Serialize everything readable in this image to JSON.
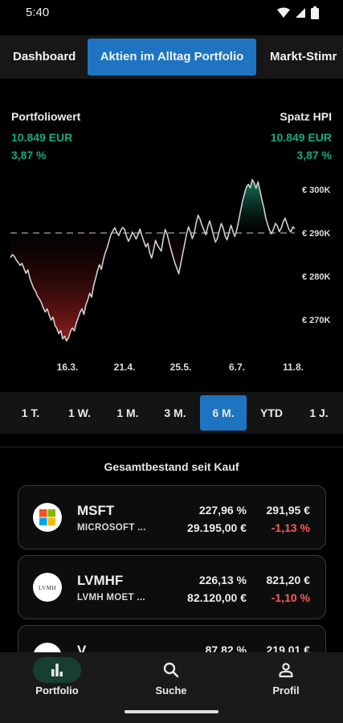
{
  "status_bar": {
    "time": "5:40"
  },
  "tabs": [
    {
      "label": "Dashboard",
      "active": false
    },
    {
      "label": "Aktien im Alltag Portfolio",
      "active": true
    },
    {
      "label": "Markt-Stimr",
      "active": false
    }
  ],
  "portfolio": {
    "left_title": "Portfoliowert",
    "left_value": "10.849 EUR",
    "left_pct": "3,87 %",
    "right_title": "Spatz HPI",
    "right_value": "10.849 EUR",
    "right_pct": "3,87 %"
  },
  "chart_data": {
    "type": "line",
    "y_tick_labels": [
      "€ 300K",
      "€ 290K",
      "€ 280K",
      "€ 270K"
    ],
    "y_ticks": [
      300,
      290,
      280,
      270
    ],
    "x_tick_labels": [
      "16.3.",
      "21.4.",
      "25.5.",
      "6.7.",
      "11.8."
    ],
    "baseline": 290,
    "ylim": [
      262,
      304
    ],
    "series": [
      {
        "values": [
          284.3,
          285,
          284.6,
          283.8,
          283.2,
          282.5,
          283,
          281.8,
          280.7,
          281.5,
          279.6,
          278.4,
          277.2,
          276.6,
          275.4,
          274.8,
          273.9,
          272.7,
          271.8,
          272.5,
          271.1,
          269.9,
          270.6,
          268.7,
          268,
          266.8,
          267.5,
          265.6,
          266.2,
          265.1,
          265.8,
          267.3,
          268.1,
          267.4,
          269.2,
          270.4,
          271.7,
          272.5,
          271.2,
          273.4,
          274.6,
          276.1,
          275.2,
          277.9,
          279.5,
          281.3,
          282.7,
          281.6,
          283.8,
          285.4,
          286.6,
          288.2,
          289.7,
          290.5,
          291.2,
          290.1,
          289.4,
          290.6,
          291.3,
          290.8,
          289.2,
          288.1,
          288.9,
          290.2,
          289.5,
          288.6,
          289.7,
          290.9,
          289.3,
          288,
          286.8,
          287.6,
          285.4,
          284.2,
          286.1,
          288.3,
          287.2,
          286.5,
          285.8,
          288.6,
          290.8,
          289.7,
          287.9,
          286.2,
          284.6,
          283.1,
          281.9,
          280.6,
          282.8,
          285.1,
          287.3,
          289.6,
          291.4,
          290.2,
          288.7,
          289.9,
          292.3,
          294.1,
          293.2,
          291.8,
          290.7,
          289.6,
          291.4,
          292.8,
          291.2,
          289.4,
          287.9,
          288.8,
          290.6,
          292.2,
          291.1,
          289.3,
          288.4,
          290.1,
          291.8,
          290.4,
          289.2,
          290.7,
          292.9,
          295.2,
          297.4,
          299.1,
          300.6,
          301.2,
          300.4,
          302.3,
          301.6,
          300.3,
          301.8,
          299.7,
          297.6,
          295.8,
          293.4,
          291.9,
          290.6,
          289.8,
          290.9,
          292.2,
          291.6,
          290.3,
          291.1,
          292.6,
          293.4,
          292.1,
          290.8,
          290.2,
          291.4,
          291
        ]
      }
    ]
  },
  "time_ranges": [
    {
      "label": "1 T.",
      "active": false
    },
    {
      "label": "1 W.",
      "active": false
    },
    {
      "label": "1 M.",
      "active": false
    },
    {
      "label": "3 M.",
      "active": false
    },
    {
      "label": "6 M.",
      "active": true
    },
    {
      "label": "YTD",
      "active": false
    },
    {
      "label": "1 J.",
      "active": false
    }
  ],
  "holdings_title": "Gesamtbestand seit Kauf",
  "holdings": [
    {
      "symbol": "MSFT",
      "name": "MICROSOFT ...",
      "pct_gain": "227,96 %",
      "price": "291,95 €",
      "value": "29.195,00 €",
      "day_change": "-1,13 %",
      "logo_icon": "microsoft-logo-icon",
      "logo_text": ""
    },
    {
      "symbol": "LVMHF",
      "name": "LVMH MOET ...",
      "pct_gain": "226,13 %",
      "price": "821,20 €",
      "value": "82.120,00 €",
      "day_change": "-1,10 %",
      "logo_icon": "lvmh-logo-icon",
      "logo_text": "LVMH"
    },
    {
      "symbol": "V",
      "name": "",
      "pct_gain": "87,82 %",
      "price": "219,01 €",
      "value": "",
      "day_change": "",
      "logo_icon": "visa-logo-icon",
      "logo_text": ""
    }
  ],
  "nav": [
    {
      "label": "Portfolio",
      "icon": "bar-chart-icon",
      "active": true
    },
    {
      "label": "Suche",
      "icon": "search-icon",
      "active": false
    },
    {
      "label": "Profil",
      "icon": "person-icon",
      "active": false
    }
  ],
  "colors": {
    "accent_blue": "#1e74c0",
    "gain_green": "#18a983",
    "loss_red": "#ff5a5a",
    "chart_line": "#cfcfcf"
  }
}
